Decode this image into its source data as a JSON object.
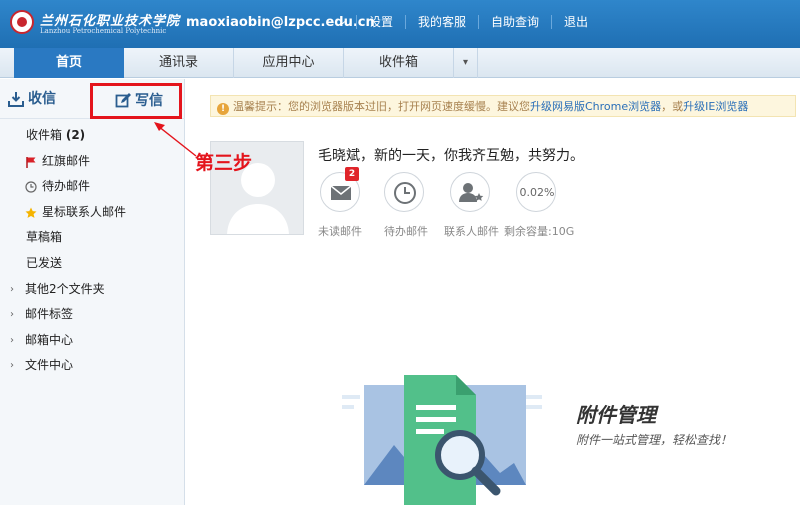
{
  "header": {
    "logo_cn": "兰州石化职业技术学院",
    "logo_en": "Lanzhou Petrochemical Polytechnic",
    "email": "maoxiaobin@lzpcc.edu.cn",
    "links": [
      "设置",
      "我的客服",
      "自助查询",
      "退出"
    ]
  },
  "tabs": [
    "首页",
    "通讯录",
    "应用中心",
    "收件箱"
  ],
  "sidebar": {
    "receive_label": "收信",
    "write_label": "写信",
    "folders": [
      {
        "label": "收件箱",
        "count": "(2)"
      },
      {
        "label": "红旗邮件"
      },
      {
        "label": "待办邮件"
      },
      {
        "label": "星标联系人邮件"
      },
      {
        "label": "草稿箱"
      },
      {
        "label": "已发送"
      },
      {
        "label": "其他2个文件夹"
      },
      {
        "label": "邮件标签"
      },
      {
        "label": "邮箱中心"
      },
      {
        "label": "文件中心"
      }
    ]
  },
  "annotation": "第三步",
  "notice": {
    "text": "温馨提示：您的浏览器版本过旧，打开网页速度缓慢。建议您",
    "link1": "升级网易版Chrome浏览器",
    "sep": "，或",
    "link2": "升级IE浏览器"
  },
  "profile": {
    "greeting": "毛晓斌，新的一天，你我齐互勉，共努力。",
    "unread_badge": "2",
    "quota_pct": "0.02%",
    "stats": [
      "未读邮件",
      "待办邮件",
      "联系人邮件",
      "剩余容量:10G"
    ]
  },
  "promo": {
    "title": "附件管理",
    "subtitle": "附件一站式管理，轻松查找！"
  },
  "colors": {
    "header_blue": "#2a79c2",
    "annotation_red": "#e4141c",
    "notice_bg": "#fdf6de"
  }
}
